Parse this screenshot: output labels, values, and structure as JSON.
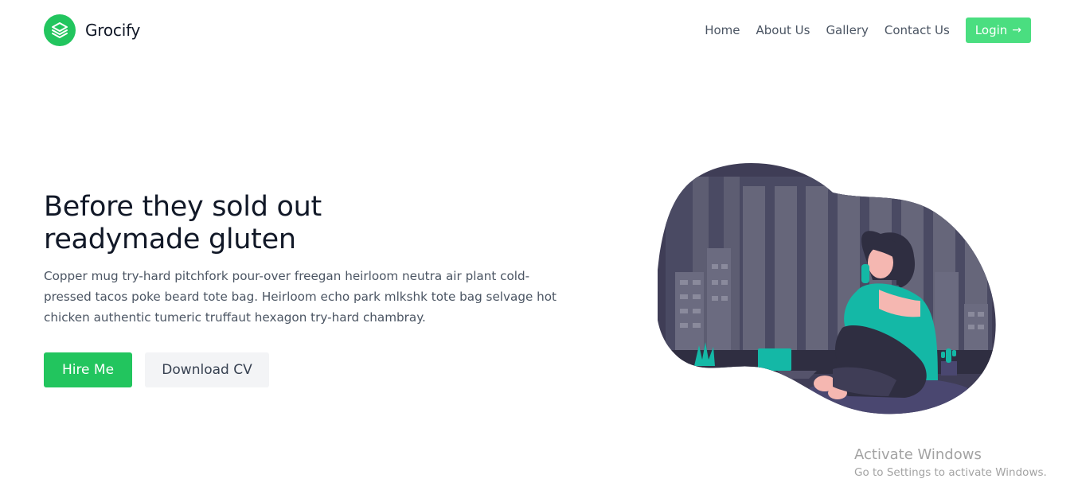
{
  "brand": {
    "name": "Grocify",
    "icon": "layers-icon",
    "color": "#22c55e"
  },
  "nav": {
    "links": [
      "Home",
      "About Us",
      "Gallery",
      "Contact Us"
    ],
    "login_label": "Login",
    "login_icon": "arrow-right-icon",
    "login_color": "#4ade80"
  },
  "hero": {
    "title_line1": "Before they sold out",
    "title_line2": "readymade gluten",
    "description": "Copper mug try-hard pitchfork pour-over freegan heirloom neutra air plant cold-pressed tacos poke beard tote bag. Heirloom echo park mlkshk tote bag selvage hot chicken authentic tumeric truffaut hexagon try-hard chambray.",
    "primary_button": "Hire Me",
    "secondary_button": "Download CV",
    "illustration": "woman-on-phone-illustration"
  },
  "watermark": {
    "title": "Activate Windows",
    "subtitle": "Go to Settings to activate Windows."
  }
}
